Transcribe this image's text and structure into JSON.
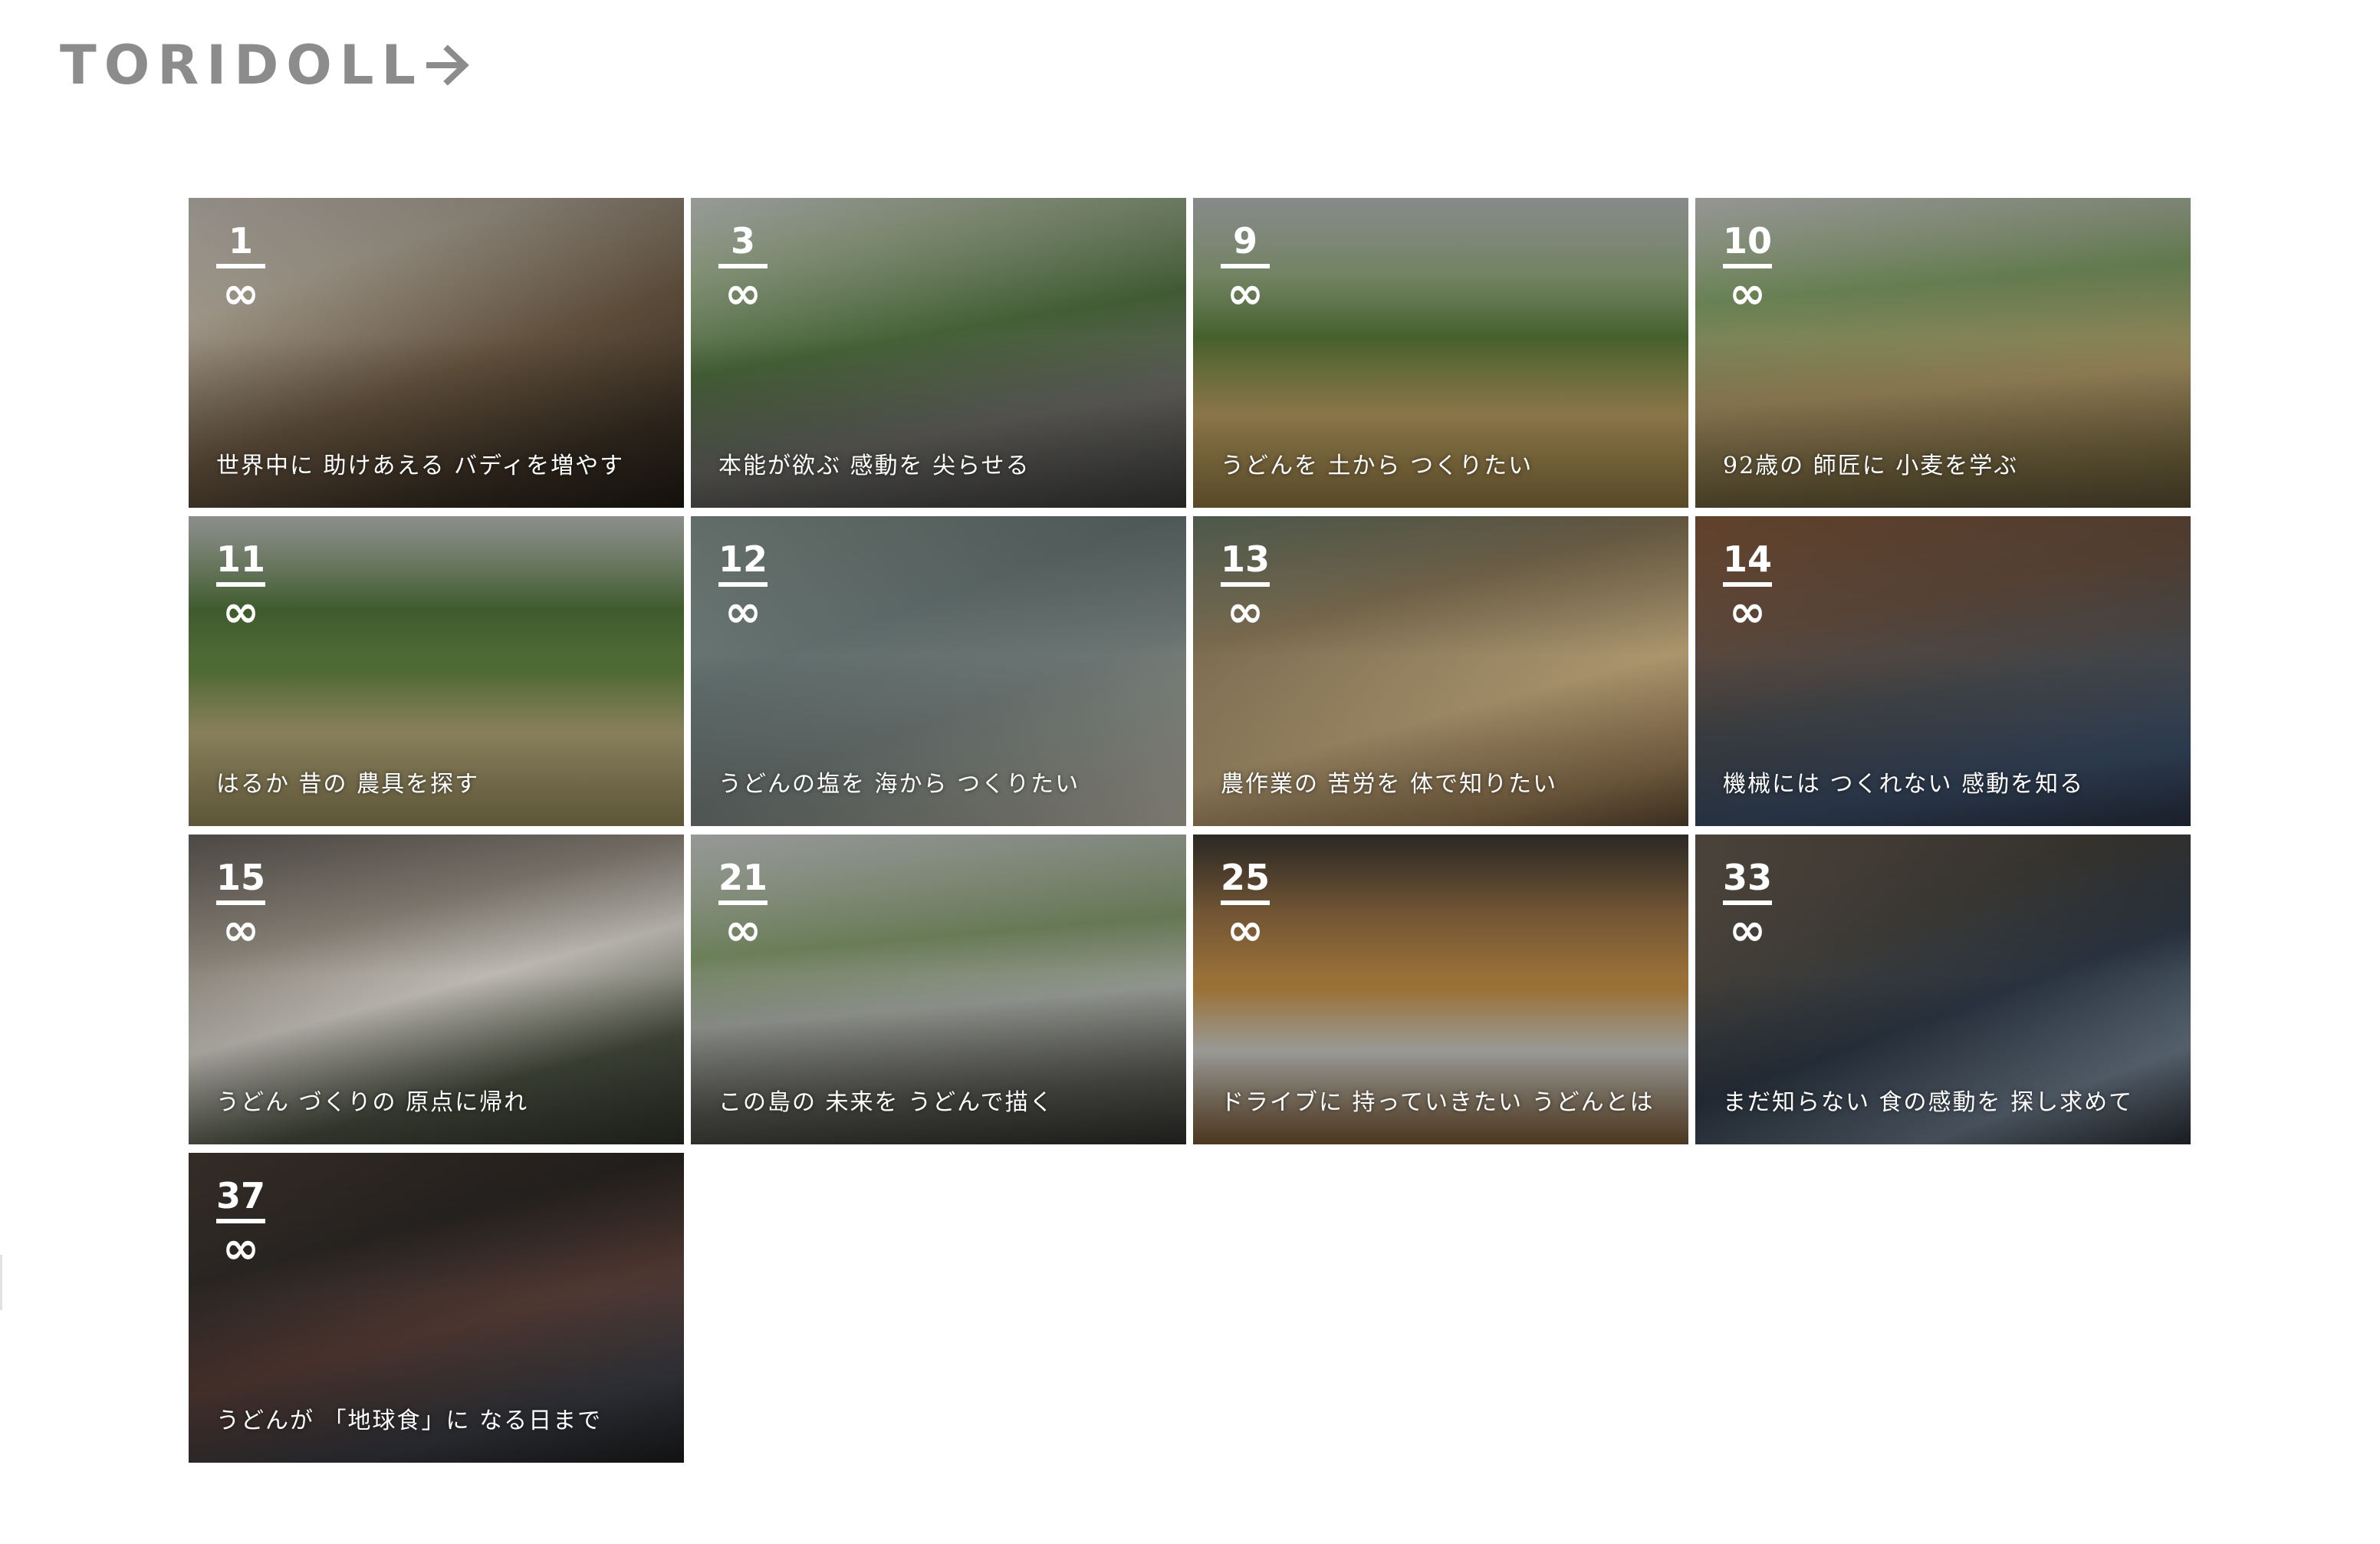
{
  "header": {
    "logo_text": "TORIDOLL",
    "logo_arrow_icon": "arrow-right-icon"
  },
  "episodes": [
    {
      "number": "1",
      "symbol": "∞",
      "caption": "世界中に 助けあえる バディを増やす"
    },
    {
      "number": "3",
      "symbol": "∞",
      "caption": "本能が欲ぶ 感動を 尖らせる"
    },
    {
      "number": "9",
      "symbol": "∞",
      "caption": "うどんを 土から つくりたい"
    },
    {
      "number": "10",
      "symbol": "∞",
      "caption": "92歳の 師匠に 小麦を学ぶ"
    },
    {
      "number": "11",
      "symbol": "∞",
      "caption": "はるか 昔の 農具を探す"
    },
    {
      "number": "12",
      "symbol": "∞",
      "caption": "うどんの塩を 海から つくりたい"
    },
    {
      "number": "13",
      "symbol": "∞",
      "caption": "農作業の 苦労を 体で知りたい"
    },
    {
      "number": "14",
      "symbol": "∞",
      "caption": "機械には つくれない 感動を知る"
    },
    {
      "number": "15",
      "symbol": "∞",
      "caption": "うどん づくりの 原点に帰れ"
    },
    {
      "number": "21",
      "symbol": "∞",
      "caption": "この島の 未来を うどんで描く"
    },
    {
      "number": "25",
      "symbol": "∞",
      "caption": "ドライブに 持っていきたい うどんとは"
    },
    {
      "number": "33",
      "symbol": "∞",
      "caption": "まだ知らない 食の感動を 探し求めて"
    },
    {
      "number": "37",
      "symbol": "∞",
      "caption": "うどんが 「地球食」に なる日まで"
    }
  ],
  "colors": {
    "logo": "#8c8c8c",
    "background": "#ffffff",
    "overlay_text": "#ffffff"
  }
}
